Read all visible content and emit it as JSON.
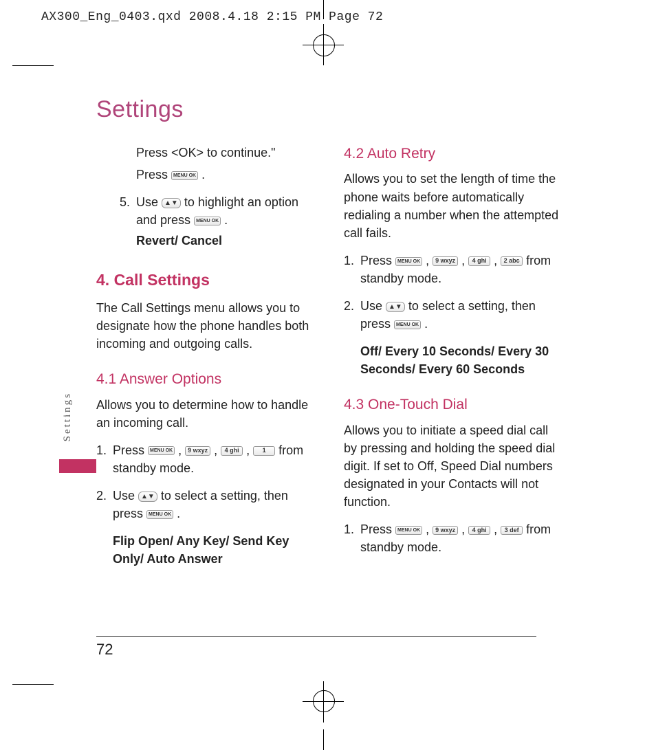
{
  "header": "AX300_Eng_0403.qxd  2008.4.18  2:15 PM  Page 72",
  "title": "Settings",
  "side_label": "Settings",
  "page_number": "72",
  "keys": {
    "ok": "MENU OK",
    "nav": "▲▼",
    "k9": "9 wxyz",
    "k4": "4 ghi",
    "k1": "1",
    "k2": "2 abc",
    "k3": "3 def"
  },
  "left": {
    "cont1": "Press <OK> to continue.\"",
    "cont2a": "Press ",
    "cont2b": " .",
    "step5_num": "5.",
    "step5a": "Use ",
    "step5b": " to highlight an option and press ",
    "step5c": " .",
    "step5_opts": "Revert/ Cancel",
    "h2": "4. Call Settings",
    "h2_body": "The Call Settings menu allows you to designate how the phone handles both incoming and outgoing calls.",
    "h3_41": "4.1 Answer Options",
    "h3_41_body": "Allows you to determine how to handle an incoming call.",
    "s41_1_num": "1.",
    "s41_1a": "Press ",
    "s41_1b": " from standby mode.",
    "s41_2_num": "2.",
    "s41_2a": "Use ",
    "s41_2b": " to select a setting, then press ",
    "s41_2c": " .",
    "s41_opts": "Flip Open/ Any Key/ Send Key Only/ Auto Answer"
  },
  "right": {
    "h3_42": "4.2 Auto Retry",
    "h3_42_body": "Allows you to set the length of time the phone waits before automatically redialing a number when the attempted call fails.",
    "s42_1_num": "1.",
    "s42_1a": "Press ",
    "s42_1b": " from standby mode.",
    "s42_2_num": "2.",
    "s42_2a": "Use ",
    "s42_2b": " to select a setting, then press ",
    "s42_2c": " .",
    "s42_opts": "Off/ Every 10 Seconds/ Every 30 Seconds/ Every 60 Seconds",
    "h3_43": "4.3 One-Touch Dial",
    "h3_43_body": "Allows you to initiate a speed dial call by pressing and holding the speed dial digit. If set to Off, Speed Dial numbers designated in your Contacts will not function.",
    "s43_1_num": "1.",
    "s43_1a": "Press ",
    "s43_1b": " from standby mode."
  }
}
